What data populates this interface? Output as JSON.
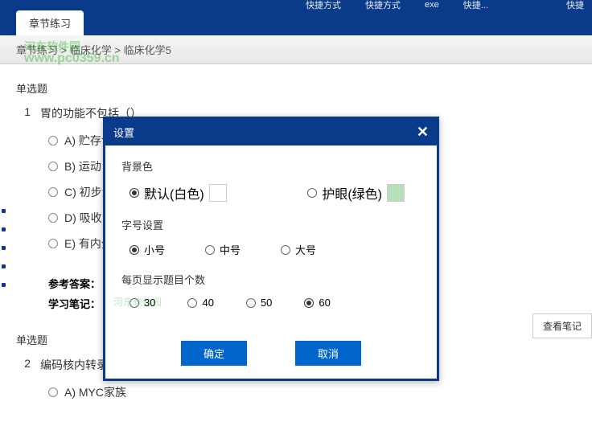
{
  "topbar": {
    "items": [
      "快捷方式",
      "快捷方式",
      "exe",
      "快捷...",
      "快捷"
    ]
  },
  "tab": {
    "label": "章节练习"
  },
  "breadcrumb": {
    "text": "章节练习 > 临床化学 > 临床化学5"
  },
  "watermark": {
    "site": "河东软件园",
    "url": "www.pc0359.cn"
  },
  "q1": {
    "section": "单选题",
    "num": "1",
    "text": "胃的功能不包括（）",
    "options": {
      "a": "A) 贮存食物",
      "b": "B) 运动",
      "c": "C) 初步消化食物",
      "d": "D) 吸收",
      "e": "E) 有内分泌能力"
    },
    "answer_label": "参考答案：",
    "notes_label": "学习笔记："
  },
  "q2": {
    "section": "单选题",
    "num": "2",
    "text": "编码核内转录因子的基因是（）",
    "options": {
      "a": "A) MYC家族"
    }
  },
  "view_notes": "查看笔记",
  "modal": {
    "title": "设置",
    "bg": {
      "label": "背景色",
      "default": "默认(白色)",
      "eye": "护眼(绿色)"
    },
    "font": {
      "label": "字号设置",
      "small": "小号",
      "medium": "中号",
      "large": "大号"
    },
    "perpage": {
      "label": "每页显示题目个数",
      "o30": "30",
      "o40": "40",
      "o50": "50",
      "o60": "60",
      "wm": "河东软件园"
    },
    "ok": "确定",
    "cancel": "取消"
  }
}
